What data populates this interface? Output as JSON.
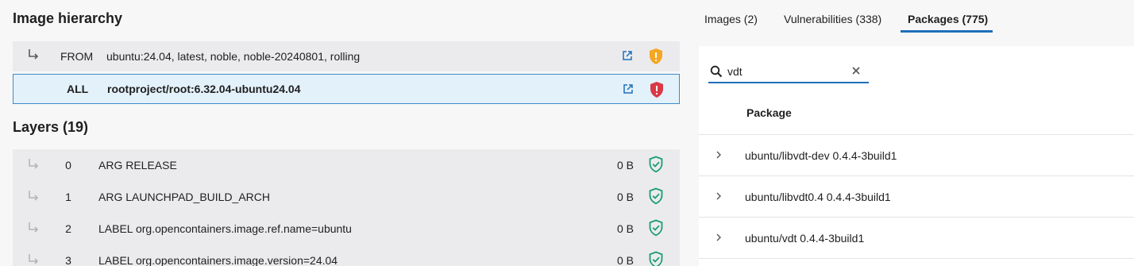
{
  "hierarchy": {
    "title": "Image hierarchy",
    "rows": [
      {
        "kind": "FROM",
        "image": "ubuntu:24.04, latest, noble, noble-20240801, rolling",
        "status_icon": "shield-warning-icon",
        "status_color": "#f5a623"
      },
      {
        "kind": "ALL",
        "image": "rootproject/root:6.32.04-ubuntu24.04",
        "status_icon": "shield-alert-icon",
        "status_color": "#d93a45"
      }
    ]
  },
  "layers": {
    "title": "Layers (19)",
    "rows": [
      {
        "index": "0",
        "command": "ARG RELEASE",
        "size": "0 B"
      },
      {
        "index": "1",
        "command": "ARG LAUNCHPAD_BUILD_ARCH",
        "size": "0 B"
      },
      {
        "index": "2",
        "command": "LABEL org.opencontainers.image.ref.name=ubuntu",
        "size": "0 B"
      },
      {
        "index": "3",
        "command": "LABEL org.opencontainers.image.version=24.04",
        "size": "0 B"
      }
    ],
    "status_color": "#1a9e6f"
  },
  "tabs": [
    {
      "label": "Images (2)",
      "active": false
    },
    {
      "label": "Vulnerabilities (338)",
      "active": false
    },
    {
      "label": "Packages (775)",
      "active": true
    }
  ],
  "packages": {
    "search": {
      "value": "vdt"
    },
    "column_header": "Package",
    "rows": [
      "ubuntu/libvdt-dev 0.4.4-3build1",
      "ubuntu/libvdt0.4 0.4.4-3build1",
      "ubuntu/vdt 0.4.4-3build1"
    ]
  },
  "colors": {
    "accent": "#1f6fb8",
    "selected_row_bg": "#e3f1fb"
  }
}
